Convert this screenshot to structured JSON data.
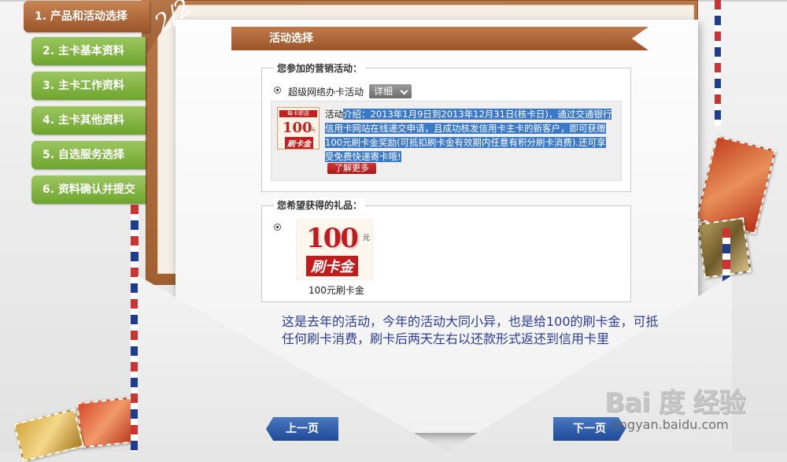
{
  "sidebar": {
    "items": [
      {
        "label": "1. 产品和活动选择",
        "active": true
      },
      {
        "label": "2. 主卡基本资料"
      },
      {
        "label": "3. 主卡工作资料"
      },
      {
        "label": "4. 主卡其他资料"
      },
      {
        "label": "5. 自选服务选择"
      },
      {
        "label": "6. 资料确认并提交"
      }
    ]
  },
  "step_badge": "2/2",
  "banner_title": "活动选择",
  "activity_section": {
    "legend": "您参加的营销活动：",
    "option_label": "超级网络办卡活动",
    "dropdown_value": "详细",
    "promo_image": {
      "tag": "每卡即送",
      "amount": "100",
      "unit": "元",
      "card_text": "刷卡金"
    },
    "description_prefix": "活动",
    "description_highlight": "介绍：2013年1月9日到2013年12月31日(核卡日)，通过交通银行信用卡网站在线递交申请，且成功核发信用卡主卡的新客户，即可获赠100元刷卡金奖励(可抵扣刷卡金有效期内任意有积分刷卡消费).还可享受免费快递寄卡哦!",
    "learn_more": "了解更多"
  },
  "gift_section": {
    "legend": "您希望获得的礼品：",
    "gift_image": {
      "amount": "100",
      "unit": "元",
      "card_text": "刷卡金"
    },
    "gift_caption": "100元刷卡金"
  },
  "annotation": "这是去年的活动，今年的活动大同小异，也是给100的刷卡金，可抵任何刷卡消费，刷卡后两天左右以还款形式返还到信用卡里",
  "nav": {
    "prev": "上一页",
    "next": "下一页"
  },
  "watermark": {
    "logo": "Bai 度 经验",
    "sub": "jingyan.baidu.com"
  },
  "colors": {
    "active_tab": "#a65f2f",
    "inactive_tab": "#7bb13b",
    "banner": "#a65f2f",
    "nav_button": "#2a57a5",
    "annotation_text": "#2b3b99",
    "highlight": "#3c79c9"
  }
}
